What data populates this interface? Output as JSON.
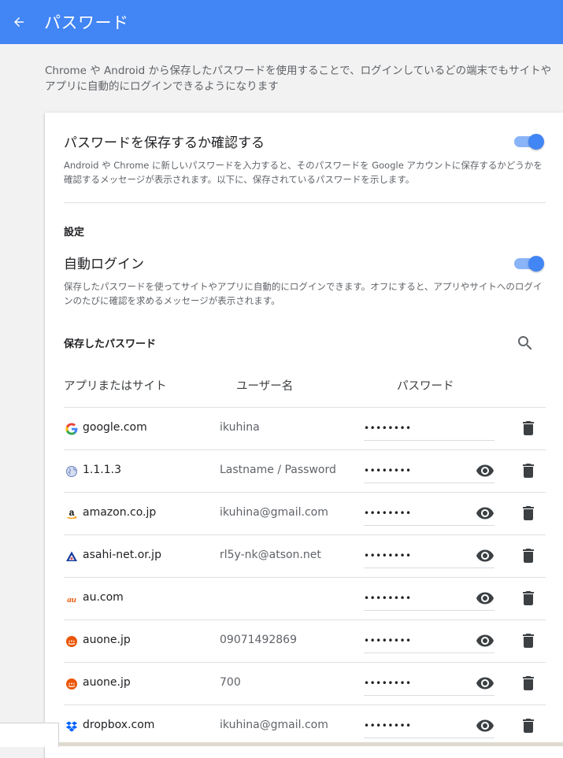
{
  "appbar": {
    "title": "パスワード",
    "back_icon": "arrow-back-icon"
  },
  "intro": {
    "text": "Chrome や Android から保存したパスワードを使用することで、ログインしているどの端末でもサイトやアプリに自動的にログインできるようになります"
  },
  "offer_save": {
    "title": "パスワードを保存するか確認する",
    "description": "Android や Chrome に新しいパスワードを入力すると、そのパスワードを Google アカウントに保存するかどうかを確認するメッセージが表示されます。以下に、保存されているパスワードを示します。",
    "enabled": true
  },
  "settings": {
    "label": "設定"
  },
  "auto_signin": {
    "title": "自動ログイン",
    "description": "保存したパスワードを使ってサイトやアプリに自動的にログインできます。オフにすると、アプリやサイトへのログインのたびに確認を求めるメッセージが表示されます。",
    "enabled": true
  },
  "saved": {
    "label": "保存したパスワード",
    "search_icon": "search-icon",
    "columns": [
      "アプリまたはサイト",
      "ユーザー名",
      "パスワード"
    ],
    "rows": [
      {
        "site": "google.com",
        "username": "ikuhina",
        "password": "••••••••",
        "favicon": "google-icon",
        "show_eye": false
      },
      {
        "site": "1.1.1.3",
        "username": "Lastname / Password",
        "password": "••••••••",
        "favicon": "globe-icon",
        "show_eye": true
      },
      {
        "site": "amazon.co.jp",
        "username": "ikuhina@gmail.com",
        "password": "••••••••",
        "favicon": "amazon-icon",
        "show_eye": true
      },
      {
        "site": "asahi-net.or.jp",
        "username": "rl5y-nk@atson.net",
        "password": "••••••••",
        "favicon": "asahi-net-icon",
        "show_eye": true
      },
      {
        "site": "au.com",
        "username": "",
        "password": "••••••••",
        "favicon": "au-icon",
        "show_eye": true
      },
      {
        "site": "auone.jp",
        "username": "09071492869",
        "password": "••••••••",
        "favicon": "auone-icon",
        "show_eye": true
      },
      {
        "site": "auone.jp",
        "username": "700",
        "password": "••••••••",
        "favicon": "auone-icon",
        "show_eye": true
      },
      {
        "site": "dropbox.com",
        "username": "ikuhina@gmail.com",
        "password": "••••••••",
        "favicon": "dropbox-icon",
        "show_eye": true
      }
    ]
  },
  "colors": {
    "primary": "#4285f4",
    "toggle_track": "#8ab4f8",
    "background": "#f2f2f2"
  }
}
